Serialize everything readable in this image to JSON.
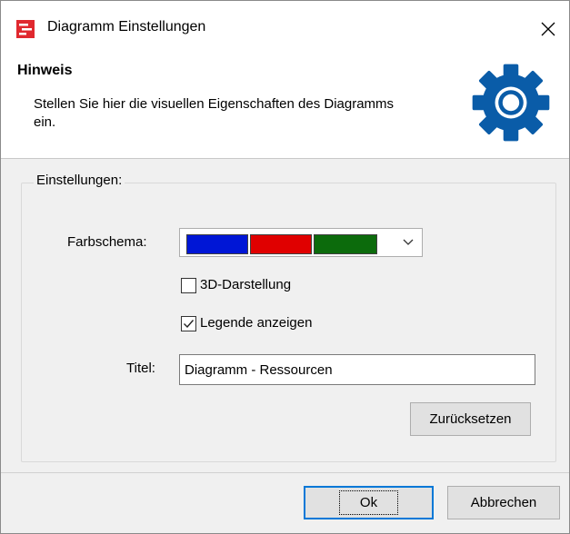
{
  "window": {
    "title": "Diagramm Einstellungen",
    "close_glyph": "✕"
  },
  "header": {
    "hint_title": "Hinweis",
    "hint_text": "Stellen Sie hier die visuellen Eigenschaften des Diagramms ein.",
    "icon": "gear-icon",
    "icon_color": "#0a5ca8"
  },
  "settings": {
    "group_label": "Einstellungen:",
    "color_scheme_label": "Farbschema:",
    "color_scheme_swatches": [
      "#0016d6",
      "#e00000",
      "#0c6b0c"
    ],
    "checkbox_3d_label": "3D-Darstellung",
    "checkbox_3d_checked": false,
    "checkbox_legend_label": "Legende anzeigen",
    "checkbox_legend_checked": true,
    "title_label": "Titel:",
    "title_value": "Diagramm - Ressourcen",
    "reset_button": "Zurücksetzen"
  },
  "footer": {
    "ok_button": "Ok",
    "cancel_button": "Abbrechen"
  }
}
